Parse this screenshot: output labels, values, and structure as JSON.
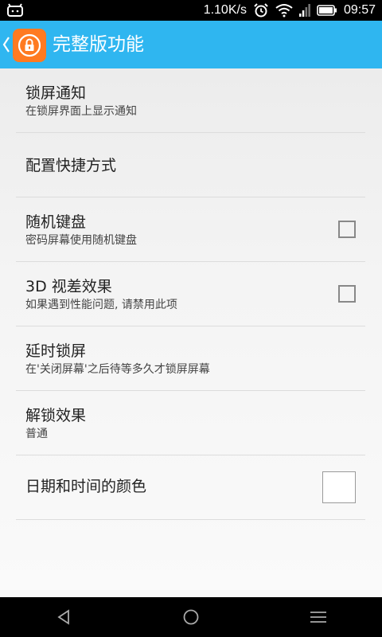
{
  "status_bar": {
    "speed": "1.10K/s",
    "time": "09:57",
    "icons": [
      "android-notification-icon",
      "alarm-icon",
      "wifi-icon",
      "signal-icon",
      "battery-icon"
    ]
  },
  "action_bar": {
    "title": "完整版功能",
    "background": "#2fb6f0",
    "app_icon": "lock-app-icon",
    "app_icon_color": "#ff7a21"
  },
  "preferences": [
    {
      "title": "锁屏通知",
      "summary": "在锁屏界面上显示通知",
      "widget": "none"
    },
    {
      "title": "配置快捷方式",
      "summary": "",
      "widget": "none"
    },
    {
      "title": "随机键盘",
      "summary": "密码屏幕使用随机键盘",
      "widget": "checkbox",
      "checked": false
    },
    {
      "title": "3D 视差效果",
      "summary": "如果遇到性能问题, 请禁用此项",
      "widget": "checkbox",
      "checked": false
    },
    {
      "title": "延时锁屏",
      "summary": "在'关闭屏幕'之后待等多久才锁屏屏幕",
      "widget": "none"
    },
    {
      "title": "解锁效果",
      "summary": "普通",
      "widget": "none"
    },
    {
      "title": "日期和时间的颜色",
      "summary": "",
      "widget": "color",
      "color": "#ffffff"
    }
  ],
  "nav_bar": {
    "buttons": [
      "back-icon",
      "home-icon",
      "menu-icon"
    ]
  }
}
